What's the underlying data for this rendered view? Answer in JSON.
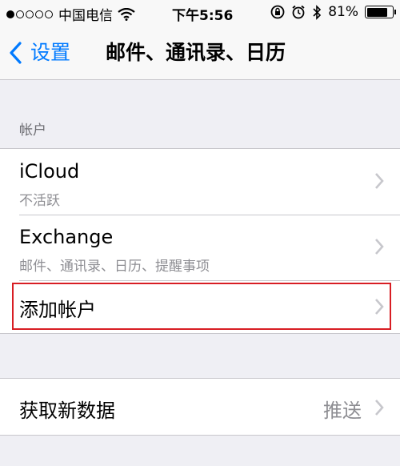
{
  "status_bar": {
    "carrier": "中国电信",
    "time": "下午5:56",
    "battery_percent": "81%",
    "battery_level": 0.81,
    "signal_bars_filled": 1,
    "signal_bars_total": 5,
    "icons": [
      "wifi-icon",
      "rotation-lock-icon",
      "alarm-icon",
      "bluetooth-icon",
      "battery-icon"
    ]
  },
  "nav": {
    "back_label": "设置",
    "title": "邮件、通讯录、日历"
  },
  "accounts_section": {
    "header": "帐户",
    "rows": [
      {
        "title": "iCloud",
        "subtitle": "不活跃"
      },
      {
        "title": "Exchange",
        "subtitle": "邮件、通讯录、日历、提醒事项"
      },
      {
        "title": "添加帐户"
      }
    ]
  },
  "fetch_section": {
    "title": "获取新数据",
    "value": "推送"
  },
  "colors": {
    "accent": "#007aff",
    "highlight": "#d81e24",
    "background": "#efeff4"
  }
}
